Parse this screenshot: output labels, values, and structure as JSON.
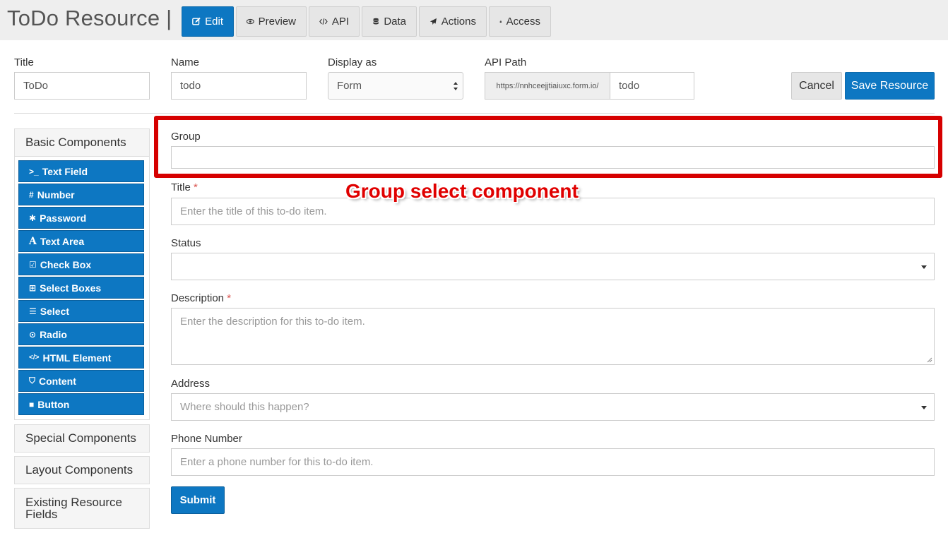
{
  "app": {
    "title": "ToDo Resource |"
  },
  "tabs": [
    {
      "label": "Edit",
      "icon": "edit-icon",
      "active": true
    },
    {
      "label": "Preview",
      "icon": "eye-icon"
    },
    {
      "label": "API",
      "icon": "code-icon"
    },
    {
      "label": "Data",
      "icon": "database-icon"
    },
    {
      "label": "Actions",
      "icon": "paper-plane-icon"
    },
    {
      "label": "Access",
      "icon": "lock-icon"
    }
  ],
  "header": {
    "title_label": "Title",
    "title_value": "ToDo",
    "name_label": "Name",
    "name_value": "todo",
    "display_label": "Display as",
    "display_value": "Form",
    "api_label": "API Path",
    "api_prefix": "https://nnhceejjtiaiuxc.form.io/",
    "api_value": "todo",
    "cancel_label": "Cancel",
    "save_label": "Save Resource"
  },
  "sidebar": {
    "basic_heading": "Basic Components",
    "components": [
      {
        "label": "Text Field",
        "icon": "terminal-icon",
        "glyph": ">_"
      },
      {
        "label": "Number",
        "icon": "hashtag-icon",
        "glyph": "#"
      },
      {
        "label": "Password",
        "icon": "asterisk-icon",
        "glyph": "✱"
      },
      {
        "label": "Text Area",
        "icon": "font-icon",
        "glyph": "A"
      },
      {
        "label": "Check Box",
        "icon": "check-square-icon",
        "glyph": "☑"
      },
      {
        "label": "Select Boxes",
        "icon": "plus-square-icon",
        "glyph": "⊞"
      },
      {
        "label": "Select",
        "icon": "list-icon",
        "glyph": "☰"
      },
      {
        "label": "Radio",
        "icon": "dot-circle-icon",
        "glyph": "⊙"
      },
      {
        "label": "HTML Element",
        "icon": "code-icon",
        "glyph": "</>"
      },
      {
        "label": "Content",
        "icon": "html5-icon",
        "glyph": "⛉"
      },
      {
        "label": "Button",
        "icon": "stop-icon",
        "glyph": "■"
      }
    ],
    "special_heading": "Special Components",
    "layout_heading": "Layout Components",
    "existing_heading": "Existing Resource Fields"
  },
  "form": {
    "group_label": "Group",
    "title_label": "Title",
    "title_placeholder": "Enter the title of this to-do item.",
    "status_label": "Status",
    "description_label": "Description",
    "description_placeholder": "Enter the description for this to-do item.",
    "address_label": "Address",
    "address_placeholder": "Where should this happen?",
    "phone_label": "Phone Number",
    "phone_placeholder": "Enter a phone number for this to-do item.",
    "required_marker": "*",
    "submit_label": "Submit"
  },
  "annotation": {
    "text": "Group select component",
    "color": "#d60000"
  },
  "colors": {
    "primary": "#0d77c2",
    "topbar": "#eeeeee"
  }
}
